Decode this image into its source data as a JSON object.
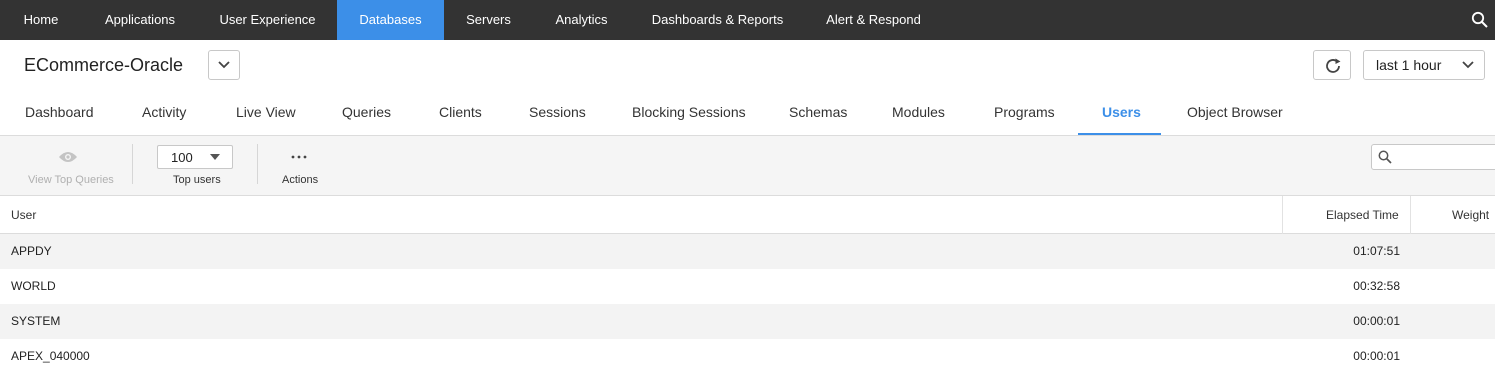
{
  "nav": {
    "items": [
      {
        "label": "Home",
        "active": false
      },
      {
        "label": "Applications",
        "active": false
      },
      {
        "label": "User Experience",
        "active": false
      },
      {
        "label": "Databases",
        "active": true
      },
      {
        "label": "Servers",
        "active": false
      },
      {
        "label": "Analytics",
        "active": false
      },
      {
        "label": "Dashboards & Reports",
        "active": false
      },
      {
        "label": "Alert & Respond",
        "active": false
      }
    ],
    "search_icon": "search-icon"
  },
  "header": {
    "db_name": "ECommerce-Oracle",
    "db_select_icon": "chevron-down-icon",
    "refresh_icon": "refresh-icon",
    "time_range": "last 1 hour"
  },
  "tabs": [
    {
      "label": "Dashboard"
    },
    {
      "label": "Activity"
    },
    {
      "label": "Live View"
    },
    {
      "label": "Queries"
    },
    {
      "label": "Clients"
    },
    {
      "label": "Sessions"
    },
    {
      "label": "Blocking Sessions"
    },
    {
      "label": "Schemas"
    },
    {
      "label": "Modules"
    },
    {
      "label": "Programs"
    },
    {
      "label": "Users",
      "active": true
    },
    {
      "label": "Object Browser"
    }
  ],
  "toolbar": {
    "view_top_queries": "View Top Queries",
    "top_users_value": "100",
    "top_users_label": "Top users",
    "actions_label": "Actions",
    "search_placeholder": ""
  },
  "table": {
    "columns": [
      "User",
      "Elapsed Time",
      "Weight"
    ],
    "rows": [
      {
        "user": "APPDY",
        "elapsed": "01:07:51"
      },
      {
        "user": "WORLD",
        "elapsed": "00:32:58"
      },
      {
        "user": "SYSTEM",
        "elapsed": "00:00:01"
      },
      {
        "user": "APEX_040000",
        "elapsed": "00:00:01"
      }
    ]
  },
  "colors": {
    "nav_bg": "#333333",
    "accent": "#3c8fe8"
  }
}
